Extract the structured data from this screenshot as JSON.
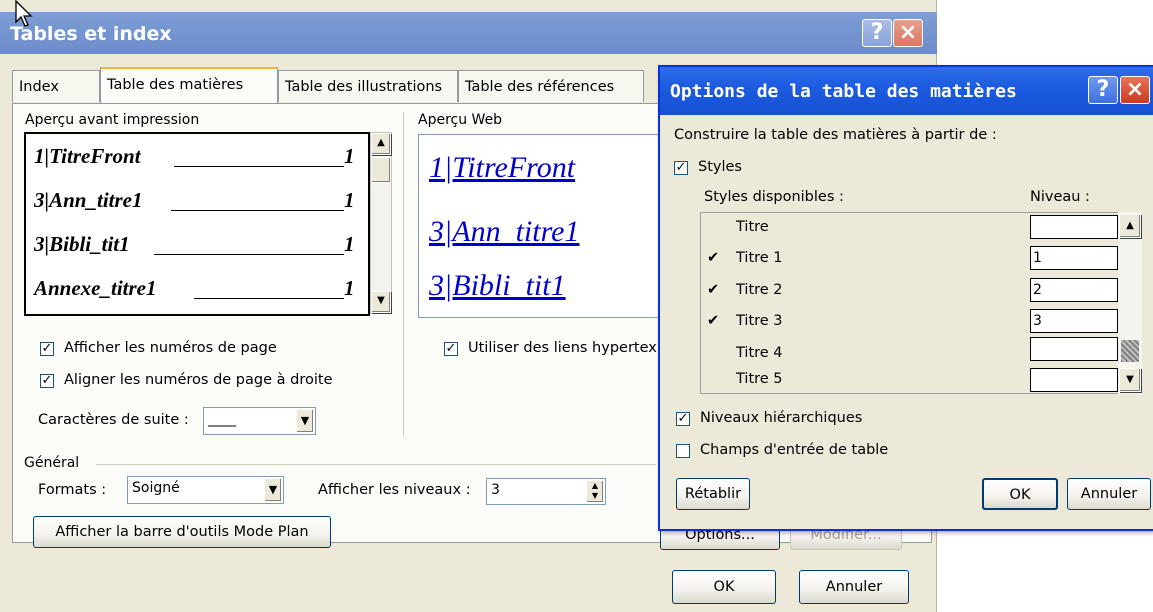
{
  "main_dialog": {
    "title": "Tables et index",
    "help_label": "?",
    "close_label": "×",
    "tabs": [
      {
        "label": "Index",
        "mnemonic_index": 4
      },
      {
        "label": "Table des matières",
        "mnemonic_index": 2
      },
      {
        "label": "Table des illustrations",
        "mnemonic_index": 10
      },
      {
        "label": "Table des références",
        "mnemonic_index": 1
      }
    ],
    "print_preview": {
      "label": "Aperçu avant impression",
      "entries": [
        {
          "text": "1|TitreFront",
          "page": "1"
        },
        {
          "text": "3|Ann_titre1",
          "page": "1"
        },
        {
          "text": "3|Bibli_tit1",
          "page": "1"
        },
        {
          "text": "Annexe_titre1",
          "page": "1"
        }
      ]
    },
    "web_preview": {
      "label": "Aperçu Web",
      "links": [
        "1|TitreFront",
        "3|Ann_titre1",
        "3|Bibli_tit1"
      ]
    },
    "show_page_numbers": {
      "label": "Afficher les numéros de page",
      "checked": true
    },
    "align_page_numbers": {
      "label": "Aligner les numéros de page à droite",
      "checked": true
    },
    "use_hyperlinks": {
      "label": "Utiliser des liens hypertex",
      "checked": true
    },
    "tab_leader": {
      "label": "Caractères de suite :",
      "value": "____"
    },
    "general": {
      "label": "Général",
      "formats_label": "Formats :",
      "formats_value": "Soigné",
      "levels_label": "Afficher les niveaux :",
      "levels_value": "3"
    },
    "outline_toolbar_button": "Afficher la barre d'outils Mode Plan",
    "options_button": "Options...",
    "modify_button": "Modifier...",
    "ok_button": "OK",
    "cancel_button": "Annuler"
  },
  "options_dialog": {
    "title": "Options de la table des matières",
    "help_label": "?",
    "close_label": "×",
    "build_from_label": "Construire la table des matières à partir de :",
    "styles_checkbox": {
      "label": "Styles",
      "checked": true
    },
    "available_styles_label": "Styles disponibles :",
    "level_label": "Niveau :",
    "styles": [
      {
        "name": "Titre",
        "checked": false,
        "level": ""
      },
      {
        "name": "Titre 1",
        "checked": true,
        "level": "1"
      },
      {
        "name": "Titre 2",
        "checked": true,
        "level": "2"
      },
      {
        "name": "Titre 3",
        "checked": true,
        "level": "3"
      },
      {
        "name": "Titre 4",
        "checked": false,
        "level": ""
      },
      {
        "name": "Titre 5",
        "checked": false,
        "level": ""
      }
    ],
    "check_mark": "✔",
    "outline_levels": {
      "label": "Niveaux hiérarchiques",
      "checked": true
    },
    "table_entry_fields": {
      "label": "Champs d'entrée de table",
      "checked": false
    },
    "reset_button": "Rétablir",
    "ok_button": "OK",
    "cancel_button": "Annuler"
  },
  "colors": {
    "dialog_bg": "#ece9d8",
    "active_titlebar": "#1d5ce0",
    "inactive_titlebar": "#7595d1",
    "link_blue": "#0000cc"
  }
}
